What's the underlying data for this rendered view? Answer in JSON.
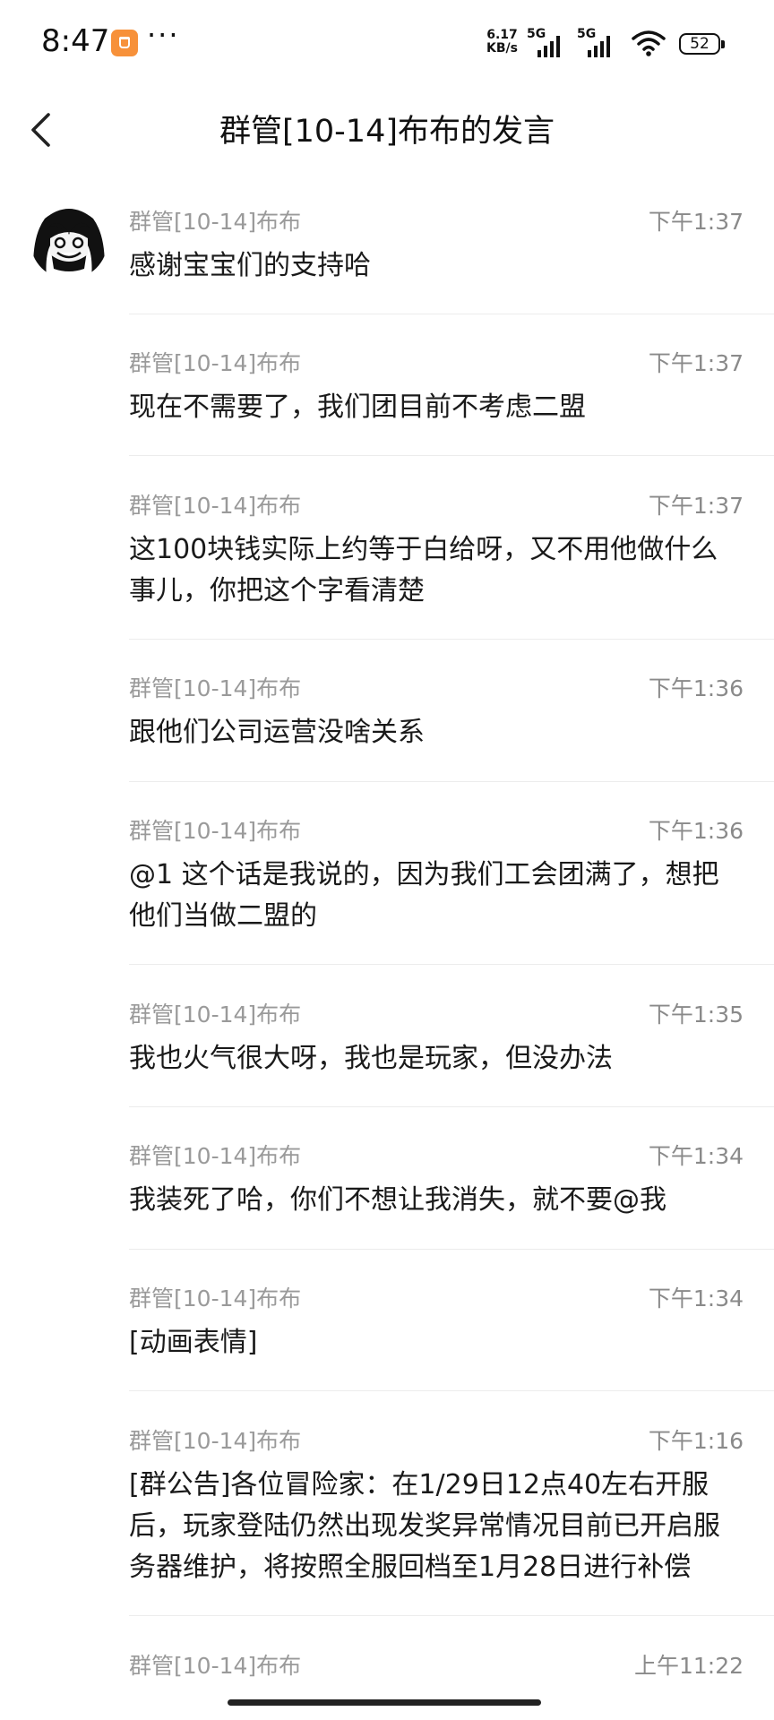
{
  "status_bar": {
    "time": "8:47",
    "more": "···",
    "speed_value": "6.17",
    "speed_unit": "KB/s",
    "sim1_label": "5G",
    "sim2_label": "5G",
    "battery": "52"
  },
  "header": {
    "title": "群管[10-14]布布的发言"
  },
  "messages": [
    {
      "sender": "群管[10-14]布布",
      "time": "下午1:37",
      "text": "感谢宝宝们的支持哈"
    },
    {
      "sender": "群管[10-14]布布",
      "time": "下午1:37",
      "text": "现在不需要了，我们团目前不考虑二盟"
    },
    {
      "sender": "群管[10-14]布布",
      "time": "下午1:37",
      "text": "这100块钱实际上约等于白给呀，又不用他做什么事儿，你把这个字看清楚"
    },
    {
      "sender": "群管[10-14]布布",
      "time": "下午1:36",
      "text": "跟他们公司运营没啥关系"
    },
    {
      "sender": "群管[10-14]布布",
      "time": "下午1:36",
      "text": "@1 这个话是我说的，因为我们工会团满了，想把他们当做二盟的"
    },
    {
      "sender": "群管[10-14]布布",
      "time": "下午1:35",
      "text": "我也火气很大呀，我也是玩家，但没办法"
    },
    {
      "sender": "群管[10-14]布布",
      "time": "下午1:34",
      "text": "我装死了哈，你们不想让我消失，就不要@我"
    },
    {
      "sender": "群管[10-14]布布",
      "time": "下午1:34",
      "text": "[动画表情]"
    },
    {
      "sender": "群管[10-14]布布",
      "time": "下午1:16",
      "text": "[群公告]各位冒险家：在1/29日12点40左右开服后，玩家登陆仍然出现发奖异常情况目前已开启服务器维护，将按照全服回档至1月28日进行补偿"
    },
    {
      "sender": "群管[10-14]布布",
      "time": "上午11:22",
      "text": ""
    }
  ]
}
